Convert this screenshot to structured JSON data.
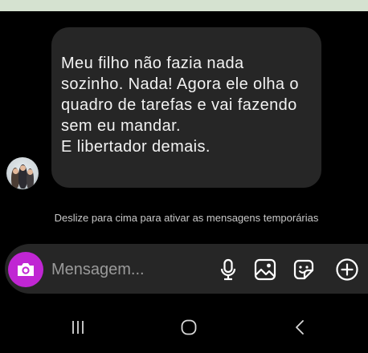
{
  "message": {
    "lines": [
      "Meu filho não fazia nada",
      "sozinho. Nada! Agora ele olha o",
      "quadro de tarefas e vai fazendo",
      "sem eu mandar.",
      "E libertador demais."
    ]
  },
  "hint": "Deslize para cima para ativar as mensagens temporárias",
  "composer": {
    "placeholder": "Mensagem...",
    "accent_color": "#c026d3"
  },
  "icons": {
    "camera": "camera-icon",
    "mic": "microphone-icon",
    "gallery": "image-icon",
    "sticker": "sticker-icon",
    "add": "plus-circle-icon",
    "recents": "recents-icon",
    "home": "home-icon",
    "back": "back-icon"
  }
}
